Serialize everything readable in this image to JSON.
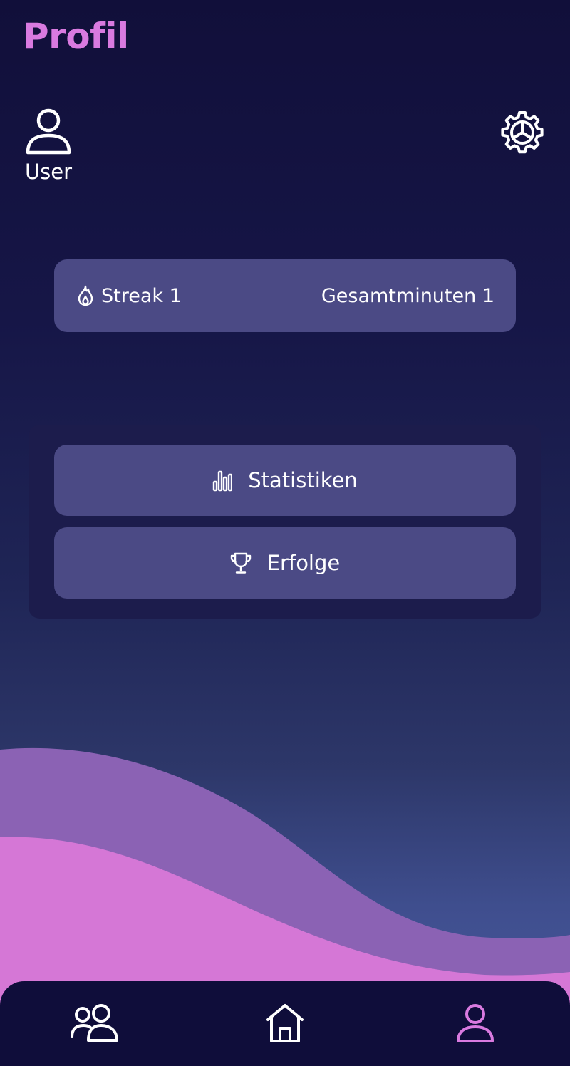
{
  "header": {
    "title": "Profil"
  },
  "user": {
    "name": "User"
  },
  "stats": {
    "streak": "Streak 1",
    "total_minutes": "Gesamtminuten 1"
  },
  "menu": {
    "statistics_label": "Statistiken",
    "achievements_label": "Erfolge"
  },
  "icons": {
    "avatar": "user-icon",
    "settings": "gear-icon",
    "streak": "flame-icon",
    "statistics": "bar-chart-icon",
    "achievements": "trophy-icon",
    "nav_friends": "users-icon",
    "nav_home": "home-icon",
    "nav_profile": "user-icon"
  },
  "nav": {
    "active": "profile"
  },
  "colors": {
    "accent": "#d97ae0",
    "card": "#4b4a85",
    "panel": "#1c1c4c",
    "nav_bg": "#0f0d3a",
    "wave_back": "#8b62b4",
    "wave_front": "#d577d6"
  }
}
